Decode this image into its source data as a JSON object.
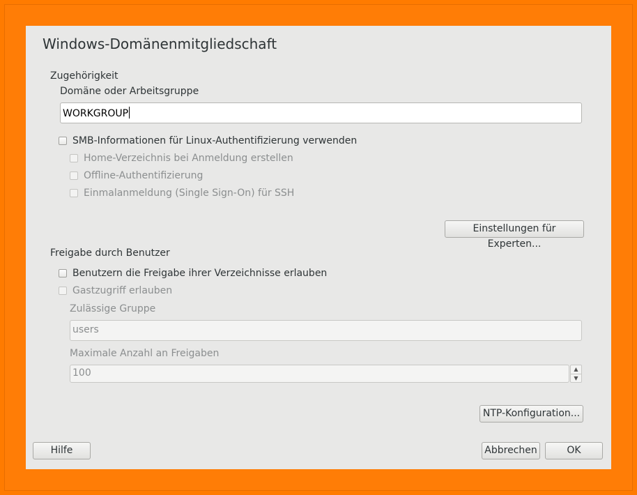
{
  "dialog": {
    "title": "Windows-Domänenmitgliedschaft",
    "membership": {
      "heading": "Zugehörigkeit",
      "domain_label": "Domäne oder Arbeitsgruppe",
      "domain_value": "WORKGROUP",
      "smb_checkbox": "SMB-Informationen für Linux-Authentifizierung verwenden",
      "sub_options": [
        "Home-Verzeichnis bei Anmeldung erstellen",
        "Offline-Authentifizierung",
        "Einmalanmeldung (Single Sign-On) für SSH"
      ],
      "expert_button": "Einstellungen für Experten..."
    },
    "sharing": {
      "heading": "Freigabe durch Benutzer",
      "allow_sharing": "Benutzern die Freigabe ihrer Verzeichnisse erlauben",
      "guest_access": "Gastzugriff erlauben",
      "group_label": "Zulässige Gruppe",
      "group_value": "users",
      "max_label": "Maximale Anzahl an Freigaben",
      "max_value": "100"
    },
    "ntp_button": "NTP-Konfiguration...",
    "help_button": "Hilfe",
    "cancel_button": "Abbrechen",
    "ok_button": "OK"
  },
  "icons": [
    "spin-up-icon",
    "spin-down-icon"
  ],
  "colors": {
    "frame": "#ff7b00",
    "dialog_bg": "#e8e8e7"
  }
}
